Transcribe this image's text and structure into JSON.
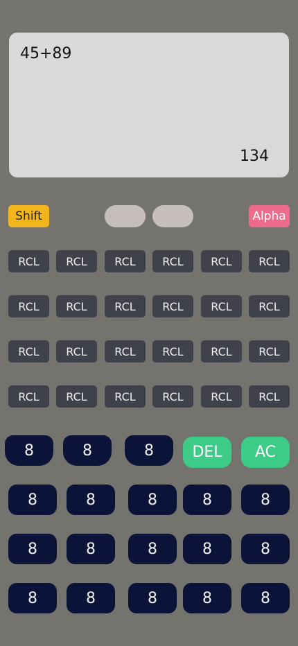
{
  "display": {
    "expression": "45+89",
    "result": "134"
  },
  "modifiers": {
    "shift_label": "Shift",
    "alpha_label": "Alpha"
  },
  "rcl_rows": [
    [
      "RCL",
      "RCL",
      "RCL",
      "RCL",
      "RCL",
      "RCL"
    ],
    [
      "RCL",
      "RCL",
      "RCL",
      "RCL",
      "RCL",
      "RCL"
    ],
    [
      "RCL",
      "RCL",
      "RCL",
      "RCL",
      "RCL",
      "RCL"
    ],
    [
      "RCL",
      "RCL",
      "RCL",
      "RCL",
      "RCL",
      "RCL"
    ]
  ],
  "keypad": {
    "row0": [
      "8",
      "8",
      "8"
    ],
    "del_label": "DEL",
    "ac_label": "AC",
    "rows": [
      [
        "8",
        "8",
        "8",
        "8",
        "8"
      ],
      [
        "8",
        "8",
        "8",
        "8",
        "8"
      ],
      [
        "8",
        "8",
        "8",
        "8",
        "8"
      ]
    ]
  },
  "colors": {
    "background": "#74736d",
    "display": "#d9d9d9",
    "shift": "#f3b51c",
    "alpha": "#ee6b8b",
    "rcl": "#3f414b",
    "number_key": "#0b1438",
    "del_ac": "#3ccc87"
  }
}
